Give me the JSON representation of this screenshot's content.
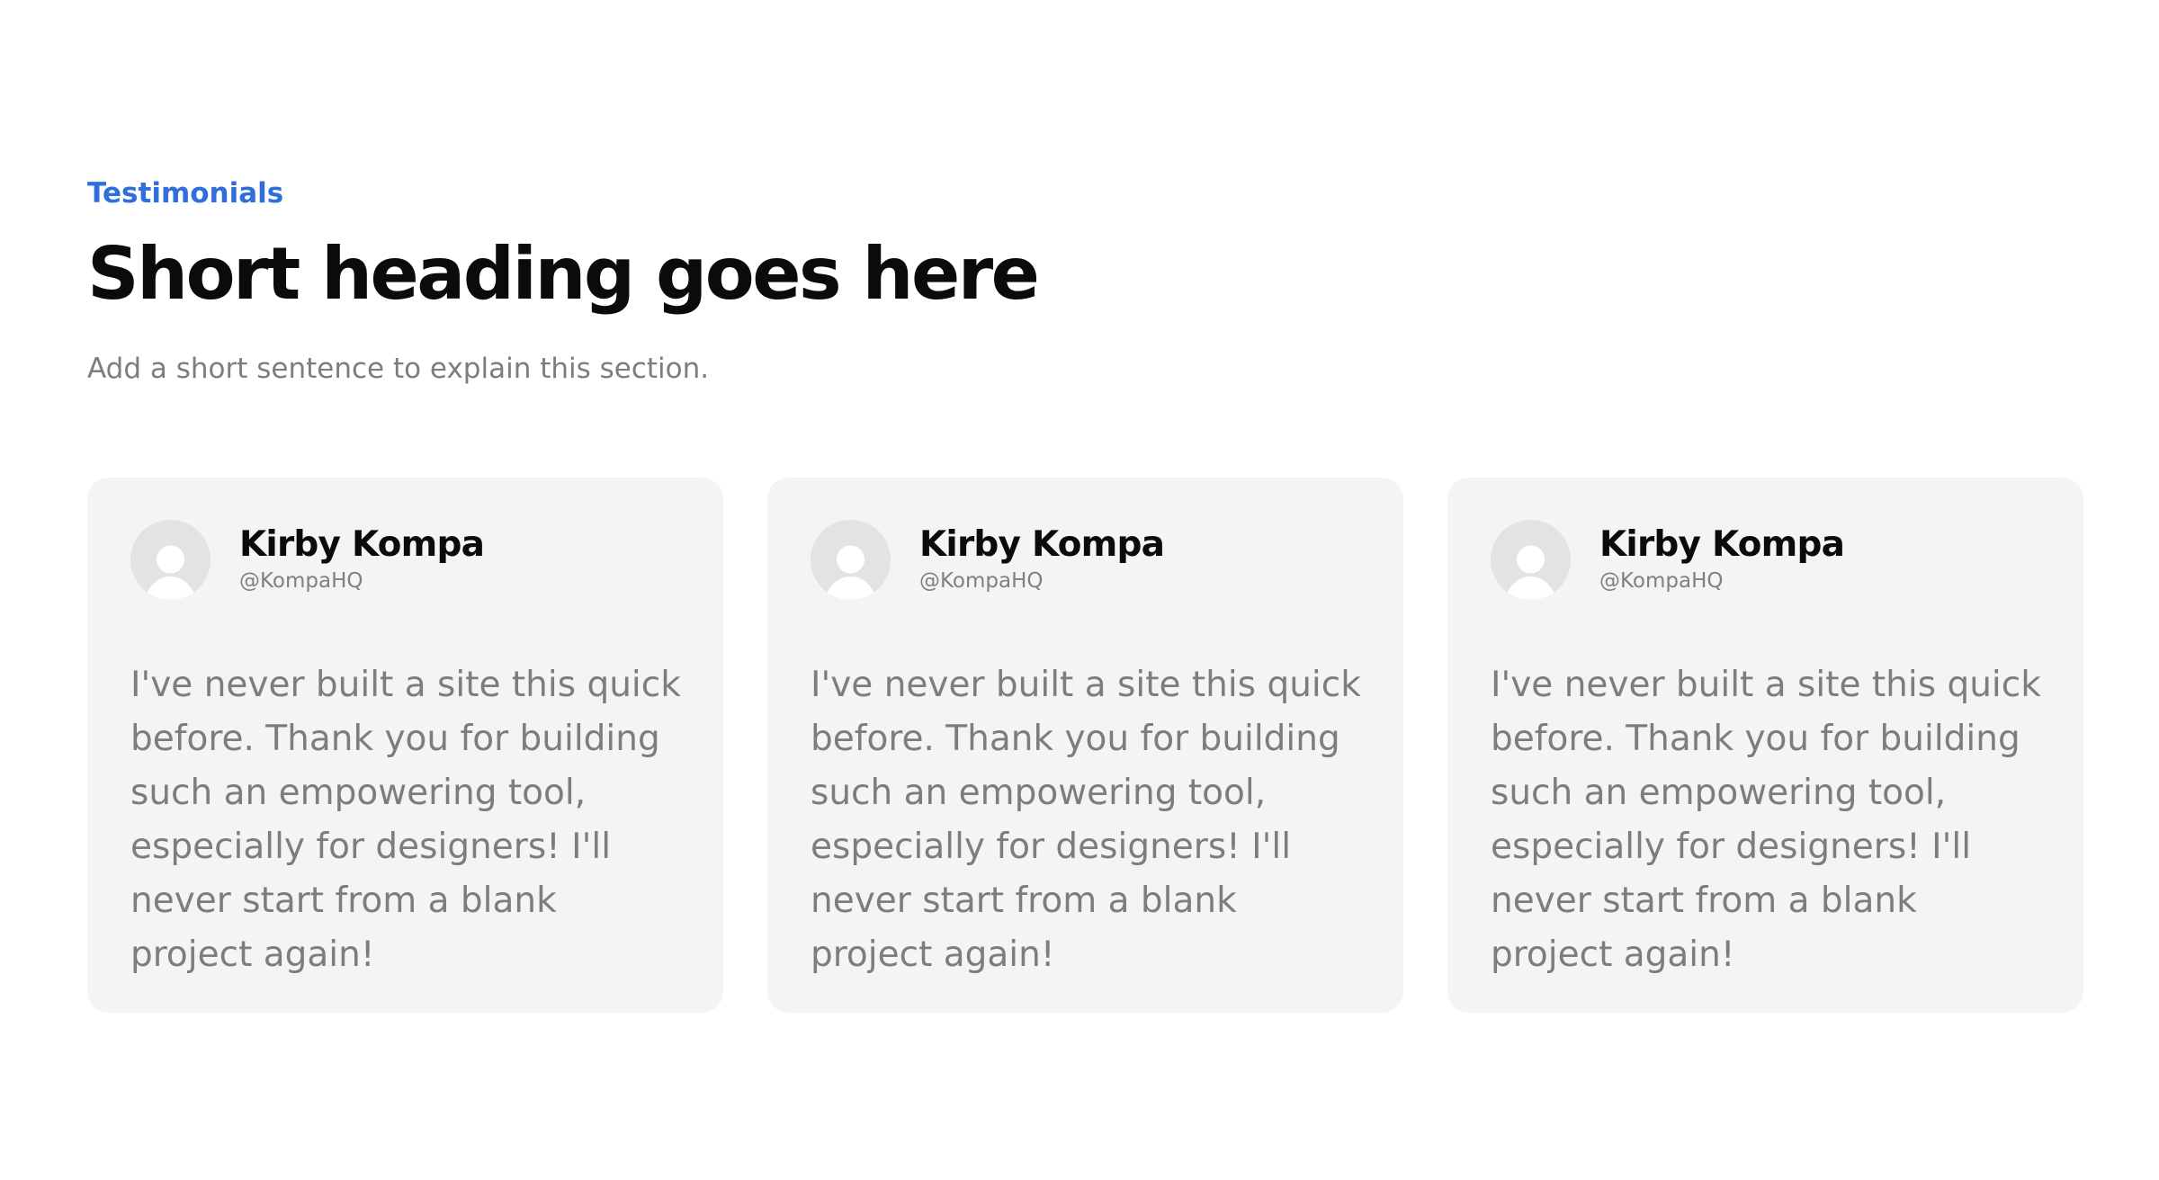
{
  "section": {
    "eyebrow": "Testimonials",
    "heading": "Short heading goes here",
    "subtitle": "Add a short sentence to explain this section."
  },
  "testimonials": [
    {
      "name": "Kirby Kompa",
      "handle": "@KompaHQ",
      "quote": "I've never built a site this quick before. Thank you for building such an empowering tool, especially for designers! I'll never start from a blank project again!",
      "avatar_icon": "user-placeholder-icon"
    },
    {
      "name": "Kirby Kompa",
      "handle": "@KompaHQ",
      "quote": "I've never built a site this quick before. Thank you for building such an empowering tool, especially for designers! I'll never start from a blank project again!",
      "avatar_icon": "user-placeholder-icon"
    },
    {
      "name": "Kirby Kompa",
      "handle": "@KompaHQ",
      "quote": "I've never built a site this quick before. Thank you for building such an empowering tool, especially for designers! I'll never start from a blank project again!",
      "avatar_icon": "user-placeholder-icon"
    }
  ],
  "colors": {
    "eyebrow": "#2f6fdb",
    "heading": "#0b0b0b",
    "muted_text": "#7d7d7d",
    "card_background": "#f4f4f4",
    "avatar_background": "#e3e3e3",
    "avatar_figure": "#ffffff"
  }
}
